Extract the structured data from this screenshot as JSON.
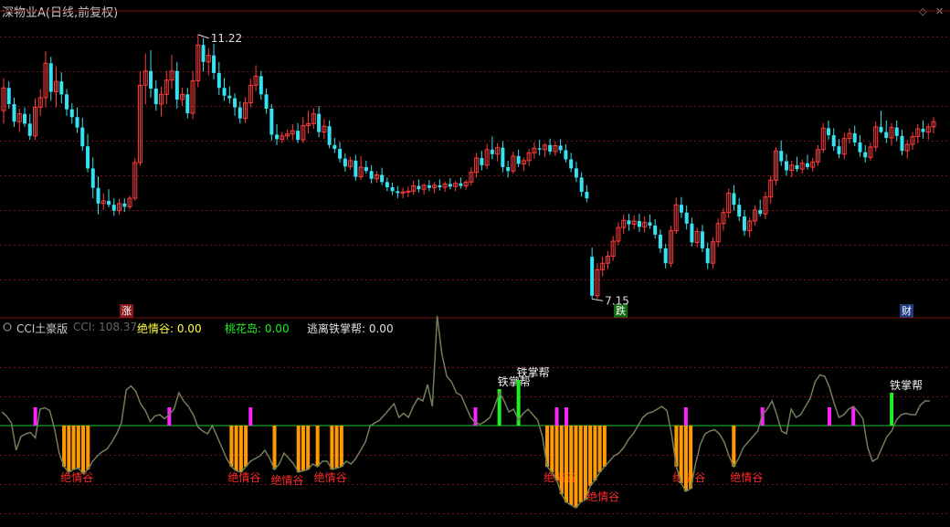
{
  "header": {
    "title": "深物业A(日线,前复权)",
    "controls": {
      "diamond_icon": "◇",
      "close_icon": "✕"
    }
  },
  "price_panel": {
    "high_label": "11.22",
    "low_label": "7.15",
    "flags": {
      "zhang": "涨",
      "die": "跌",
      "cai": "财"
    }
  },
  "indicator_panel": {
    "name": "CCI土豪版",
    "cci_label": "CCI: 108.37",
    "juqinggu_label": "绝情谷: 0.00",
    "taohuadao_label": "桃花岛: 0.00",
    "taoli_label": "逃离铁掌帮: 0.00",
    "signal_juqinggu": "绝情谷",
    "signal_tiezhangbang": "铁掌帮"
  },
  "colors": {
    "background": "#000000",
    "up_candle": "#ff3c3c",
    "down_candle": "#35e2f2",
    "gridline": "#7a1414",
    "cci_line": "#6f7f5a",
    "zero_line": "#1fcc1f",
    "magenta_bar": "#ff22ff",
    "green_bar": "#22ee22",
    "orange_bar": "#ff9a00",
    "title_text": "#c8c8c8",
    "juqinggu_text": "#ffff44",
    "taohuadao_text": "#22ee22",
    "taoli_text": "#e0e0e0",
    "signal_red": "#ff2a2a"
  },
  "chart_data": [
    {
      "type": "candlestick",
      "title": "深物业A(日线,前复权)",
      "annotations": [
        {
          "text": "11.22",
          "value": 11.22
        },
        {
          "text": "7.15",
          "value": 7.15
        }
      ],
      "markers": [
        "涨",
        "跌",
        "财"
      ],
      "grid": true,
      "ohlc": [
        [
          10.05,
          10.55,
          9.85,
          10.4
        ],
        [
          10.4,
          10.5,
          10.08,
          10.15
        ],
        [
          10.15,
          10.25,
          9.8,
          9.88
        ],
        [
          9.88,
          10.08,
          9.72,
          10.0
        ],
        [
          10.0,
          10.1,
          9.8,
          9.85
        ],
        [
          9.85,
          10.0,
          9.6,
          9.66
        ],
        [
          9.66,
          10.24,
          9.6,
          10.1
        ],
        [
          10.1,
          10.38,
          9.97,
          10.25
        ],
        [
          10.25,
          10.97,
          10.1,
          10.78
        ],
        [
          10.78,
          10.88,
          10.2,
          10.34
        ],
        [
          10.34,
          10.73,
          10.1,
          10.5
        ],
        [
          10.5,
          10.64,
          10.16,
          10.3
        ],
        [
          10.3,
          10.38,
          9.97,
          10.07
        ],
        [
          10.07,
          10.16,
          9.85,
          9.95
        ],
        [
          9.95,
          10.1,
          9.71,
          9.79
        ],
        [
          9.79,
          9.94,
          9.43,
          9.5
        ],
        [
          9.5,
          9.69,
          9.1,
          9.16
        ],
        [
          9.16,
          9.33,
          8.7,
          8.86
        ],
        [
          8.86,
          9.04,
          8.45,
          8.62
        ],
        [
          8.62,
          8.78,
          8.52,
          8.66
        ],
        [
          8.66,
          8.84,
          8.56,
          8.6
        ],
        [
          8.6,
          8.7,
          8.43,
          8.51
        ],
        [
          8.51,
          8.69,
          8.45,
          8.62
        ],
        [
          8.62,
          8.7,
          8.49,
          8.57
        ],
        [
          8.57,
          8.74,
          8.53,
          8.7
        ],
        [
          8.7,
          9.32,
          8.66,
          9.25
        ],
        [
          9.25,
          10.66,
          9.2,
          10.44
        ],
        [
          10.44,
          10.93,
          10.15,
          10.66
        ],
        [
          10.66,
          10.98,
          10.25,
          10.39
        ],
        [
          10.39,
          10.52,
          10.05,
          10.15
        ],
        [
          10.15,
          10.42,
          9.96,
          10.3
        ],
        [
          10.3,
          10.66,
          10.15,
          10.52
        ],
        [
          10.52,
          10.91,
          10.38,
          10.66
        ],
        [
          10.66,
          10.8,
          10.08,
          10.22
        ],
        [
          10.22,
          10.4,
          10.12,
          10.3
        ],
        [
          10.3,
          10.4,
          9.93,
          10.01
        ],
        [
          10.01,
          10.66,
          9.92,
          10.51
        ],
        [
          10.51,
          11.22,
          10.41,
          11.06
        ],
        [
          11.06,
          11.17,
          10.65,
          10.8
        ],
        [
          10.8,
          11.01,
          10.59,
          10.9
        ],
        [
          10.9,
          11.08,
          10.53,
          10.63
        ],
        [
          10.63,
          10.8,
          10.29,
          10.4
        ],
        [
          10.4,
          10.55,
          10.2,
          10.28
        ],
        [
          10.28,
          10.42,
          10.16,
          10.24
        ],
        [
          10.24,
          10.32,
          9.97,
          10.1
        ],
        [
          10.1,
          10.19,
          9.85,
          9.93
        ],
        [
          9.93,
          10.26,
          9.86,
          10.17
        ],
        [
          10.17,
          10.54,
          10.1,
          10.44
        ],
        [
          10.44,
          10.75,
          10.35,
          10.58
        ],
        [
          10.58,
          10.66,
          10.22,
          10.3
        ],
        [
          10.3,
          10.39,
          10.0,
          10.08
        ],
        [
          10.08,
          10.15,
          9.59,
          9.68
        ],
        [
          9.68,
          9.84,
          9.52,
          9.61
        ],
        [
          9.61,
          9.72,
          9.55,
          9.66
        ],
        [
          9.66,
          9.76,
          9.6,
          9.69
        ],
        [
          9.69,
          9.84,
          9.6,
          9.74
        ],
        [
          9.74,
          9.86,
          9.55,
          9.6
        ],
        [
          9.6,
          9.95,
          9.55,
          9.82
        ],
        [
          9.82,
          10.05,
          9.7,
          9.85
        ],
        [
          9.85,
          10.09,
          9.77,
          10.0
        ],
        [
          10.0,
          10.12,
          9.64,
          9.72
        ],
        [
          9.72,
          9.92,
          9.61,
          9.81
        ],
        [
          9.81,
          9.9,
          9.47,
          9.52
        ],
        [
          9.52,
          9.63,
          9.4,
          9.46
        ],
        [
          9.46,
          9.57,
          9.25,
          9.31
        ],
        [
          9.31,
          9.39,
          9.11,
          9.19
        ],
        [
          9.19,
          9.34,
          9.14,
          9.28
        ],
        [
          9.28,
          9.37,
          8.97,
          9.03
        ],
        [
          9.03,
          9.35,
          8.98,
          9.18
        ],
        [
          9.18,
          9.28,
          9.08,
          9.12
        ],
        [
          9.12,
          9.21,
          8.93,
          9.0
        ],
        [
          9.0,
          9.12,
          8.94,
          9.06
        ],
        [
          9.06,
          9.17,
          8.9,
          8.95
        ],
        [
          8.95,
          9.02,
          8.81,
          8.87
        ],
        [
          8.87,
          8.94,
          8.75,
          8.81
        ],
        [
          8.81,
          8.89,
          8.7,
          8.78
        ],
        [
          8.78,
          8.86,
          8.7,
          8.8
        ],
        [
          8.8,
          8.88,
          8.72,
          8.81
        ],
        [
          8.81,
          8.97,
          8.75,
          8.89
        ],
        [
          8.89,
          8.99,
          8.79,
          8.84
        ],
        [
          8.84,
          8.93,
          8.76,
          8.9
        ],
        [
          8.9,
          8.98,
          8.81,
          8.86
        ],
        [
          8.86,
          8.95,
          8.78,
          8.9
        ],
        [
          8.9,
          8.99,
          8.82,
          8.87
        ],
        [
          8.87,
          8.96,
          8.8,
          8.92
        ],
        [
          8.92,
          9.01,
          8.84,
          8.88
        ],
        [
          8.88,
          8.97,
          8.81,
          8.93
        ],
        [
          8.93,
          9.02,
          8.85,
          8.89
        ],
        [
          8.89,
          8.98,
          8.83,
          8.95
        ],
        [
          8.95,
          9.18,
          8.9,
          9.1
        ],
        [
          9.1,
          9.4,
          9.02,
          9.32
        ],
        [
          9.32,
          9.43,
          9.13,
          9.21
        ],
        [
          9.21,
          9.54,
          9.15,
          9.45
        ],
        [
          9.45,
          9.65,
          9.3,
          9.38
        ],
        [
          9.38,
          9.55,
          9.27,
          9.48
        ],
        [
          9.48,
          9.58,
          9.1,
          9.18
        ],
        [
          9.18,
          9.28,
          9.02,
          9.12
        ],
        [
          9.12,
          9.42,
          9.08,
          9.35
        ],
        [
          9.35,
          9.45,
          9.18,
          9.23
        ],
        [
          9.23,
          9.33,
          9.12,
          9.28
        ],
        [
          9.28,
          9.46,
          9.2,
          9.4
        ],
        [
          9.4,
          9.56,
          9.31,
          9.47
        ],
        [
          9.47,
          9.6,
          9.36,
          9.45
        ],
        [
          9.45,
          9.55,
          9.33,
          9.52
        ],
        [
          9.52,
          9.62,
          9.37,
          9.42
        ],
        [
          9.42,
          9.58,
          9.35,
          9.51
        ],
        [
          9.51,
          9.61,
          9.39,
          9.44
        ],
        [
          9.44,
          9.53,
          9.25,
          9.3
        ],
        [
          9.3,
          9.4,
          9.1,
          9.16
        ],
        [
          9.16,
          9.26,
          8.95,
          9.02
        ],
        [
          9.02,
          9.1,
          8.73,
          8.8
        ],
        [
          8.8,
          8.9,
          8.64,
          8.7
        ],
        [
          7.8,
          7.94,
          7.15,
          7.2
        ],
        [
          7.2,
          7.7,
          7.15,
          7.6
        ],
        [
          7.6,
          7.8,
          7.5,
          7.7
        ],
        [
          7.7,
          7.89,
          7.61,
          7.81
        ],
        [
          7.81,
          8.12,
          7.74,
          8.04
        ],
        [
          8.04,
          8.33,
          7.98,
          8.25
        ],
        [
          8.25,
          8.45,
          8.15,
          8.36
        ],
        [
          8.36,
          8.46,
          8.2,
          8.3
        ],
        [
          8.3,
          8.44,
          8.22,
          8.35
        ],
        [
          8.35,
          8.46,
          8.18,
          8.26
        ],
        [
          8.26,
          8.42,
          8.17,
          8.33
        ],
        [
          8.33,
          8.45,
          8.23,
          8.28
        ],
        [
          8.28,
          8.38,
          8.08,
          8.14
        ],
        [
          8.14,
          8.22,
          7.86,
          7.93
        ],
        [
          7.93,
          8.0,
          7.62,
          7.7
        ],
        [
          7.7,
          8.28,
          7.64,
          8.2
        ],
        [
          8.2,
          8.71,
          8.15,
          8.6
        ],
        [
          8.6,
          8.72,
          8.4,
          8.48
        ],
        [
          8.48,
          8.59,
          8.22,
          8.31
        ],
        [
          8.31,
          8.4,
          7.96,
          8.02
        ],
        [
          8.02,
          8.25,
          7.95,
          8.19
        ],
        [
          8.19,
          8.29,
          7.87,
          7.93
        ],
        [
          7.93,
          8.02,
          7.61,
          7.7
        ],
        [
          7.7,
          8.1,
          7.62,
          8.03
        ],
        [
          8.03,
          8.39,
          7.95,
          8.31
        ],
        [
          8.31,
          8.55,
          8.2,
          8.48
        ],
        [
          8.48,
          8.85,
          8.4,
          8.78
        ],
        [
          8.78,
          8.9,
          8.51,
          8.6
        ],
        [
          8.6,
          8.7,
          8.35,
          8.42
        ],
        [
          8.42,
          8.52,
          8.12,
          8.2
        ],
        [
          8.2,
          8.4,
          8.1,
          8.35
        ],
        [
          8.35,
          8.59,
          8.28,
          8.52
        ],
        [
          8.52,
          8.68,
          8.42,
          8.46
        ],
        [
          8.46,
          8.8,
          8.38,
          8.72
        ],
        [
          8.72,
          9.05,
          8.62,
          8.98
        ],
        [
          8.98,
          9.49,
          8.9,
          9.43
        ],
        [
          9.43,
          9.59,
          9.2,
          9.27
        ],
        [
          9.27,
          9.38,
          9.05,
          9.13
        ],
        [
          9.13,
          9.28,
          9.02,
          9.21
        ],
        [
          9.21,
          9.34,
          9.11,
          9.15
        ],
        [
          9.15,
          9.3,
          9.08,
          9.24
        ],
        [
          9.24,
          9.37,
          9.14,
          9.18
        ],
        [
          9.18,
          9.32,
          9.11,
          9.26
        ],
        [
          9.26,
          9.52,
          9.2,
          9.45
        ],
        [
          9.45,
          9.86,
          9.4,
          9.78
        ],
        [
          9.78,
          9.9,
          9.6,
          9.67
        ],
        [
          9.67,
          9.78,
          9.43,
          9.5
        ],
        [
          9.5,
          9.61,
          9.32,
          9.38
        ],
        [
          9.38,
          9.71,
          9.3,
          9.62
        ],
        [
          9.62,
          9.78,
          9.54,
          9.7
        ],
        [
          9.7,
          9.82,
          9.5,
          9.56
        ],
        [
          9.56,
          9.67,
          9.34,
          9.41
        ],
        [
          9.41,
          9.52,
          9.25,
          9.33
        ],
        [
          9.33,
          9.56,
          9.28,
          9.49
        ],
        [
          9.49,
          9.88,
          9.42,
          9.8
        ],
        [
          9.8,
          10.05,
          9.7,
          9.72
        ],
        [
          9.72,
          9.9,
          9.55,
          9.63
        ],
        [
          9.63,
          9.86,
          9.51,
          9.79
        ],
        [
          9.79,
          9.9,
          9.58,
          9.66
        ],
        [
          9.66,
          9.76,
          9.36,
          9.43
        ],
        [
          9.43,
          9.6,
          9.31,
          9.53
        ],
        [
          9.53,
          9.72,
          9.45,
          9.65
        ],
        [
          9.65,
          9.84,
          9.55,
          9.77
        ],
        [
          9.77,
          9.9,
          9.62,
          9.72
        ],
        [
          9.72,
          9.85,
          9.6,
          9.8
        ],
        [
          9.8,
          9.95,
          9.7,
          9.88
        ]
      ]
    },
    {
      "type": "line",
      "title": "CCI土豪版",
      "series": [
        {
          "name": "CCI",
          "values": [
            50,
            35,
            10,
            -90,
            -40,
            -30,
            -25,
            -45,
            60,
            65,
            55,
            -10,
            -100,
            -150,
            -170,
            -160,
            -155,
            -175,
            -160,
            -130,
            -110,
            -95,
            -85,
            -60,
            -30,
            10,
            130,
            145,
            125,
            80,
            55,
            15,
            35,
            40,
            25,
            40,
            60,
            120,
            90,
            70,
            40,
            -5,
            -20,
            -30,
            0,
            -40,
            -80,
            -120,
            -150,
            -165,
            -170,
            -150,
            -130,
            -120,
            -110,
            -90,
            -120,
            -160,
            -140,
            -100,
            -120,
            -140,
            -170,
            -165,
            -160,
            -140,
            -150,
            -130,
            -130,
            -160,
            -155,
            -150,
            -130,
            -140,
            -120,
            -90,
            -60,
            0,
            10,
            20,
            40,
            60,
            80,
            30,
            45,
            30,
            70,
            100,
            90,
            150,
            70,
            400,
            260,
            180,
            160,
            120,
            110,
            70,
            30,
            10,
            5,
            15,
            30,
            70,
            120,
            90,
            50,
            60,
            20,
            45,
            60,
            40,
            20,
            -40,
            -150,
            -170,
            -200,
            -250,
            -280,
            -290,
            -300,
            -280,
            -270,
            -220,
            -200,
            -170,
            -150,
            -130,
            -110,
            -100,
            -80,
            -50,
            -30,
            0,
            30,
            45,
            50,
            60,
            70,
            55,
            -30,
            -150,
            -210,
            -240,
            -230,
            -140,
            -70,
            -30,
            -20,
            -15,
            -30,
            -60,
            -110,
            -150,
            -120,
            -80,
            -60,
            -40,
            -20,
            40,
            60,
            90,
            40,
            -20,
            -30,
            60,
            30,
            40,
            70,
            100,
            160,
            185,
            180,
            140,
            80,
            30,
            40,
            60,
            70,
            50,
            25,
            -80,
            -130,
            -120,
            -80,
            -40,
            -20,
            20,
            40,
            45,
            40,
            40,
            75,
            90,
            90
          ]
        }
      ],
      "zero_line": 0
    }
  ]
}
